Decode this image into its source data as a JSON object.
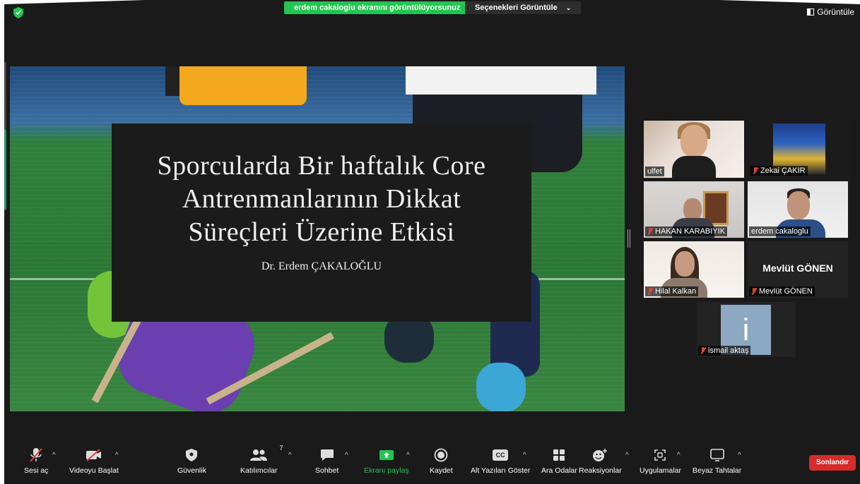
{
  "header": {
    "share_banner": "erdem cakaloglu ekranını görüntülüyorsunuz",
    "options_label": "Seçenekleri Görüntüle",
    "view_label": "Görüntüle"
  },
  "slide": {
    "title_line1": "Sporcularda Bir haftalık Core",
    "title_line2": "Antrenmanlarının Dikkat",
    "title_line3": "Süreçleri Üzerine Etkisi",
    "subtitle": "Dr. Erdem ÇAKALOĞLU"
  },
  "participants": [
    {
      "name": "ulfet",
      "muted": false
    },
    {
      "name": "Zekai ÇAKIR",
      "muted": true,
      "active_speaker": true
    },
    {
      "name": "HAKAN KARABIYIK",
      "muted": true
    },
    {
      "name": "erdem cakaloglu",
      "muted": false
    },
    {
      "name": "Hilal Kalkan",
      "muted": true
    },
    {
      "name": "Mevlüt GÖNEN",
      "display_name": "Mevlüt GÖNEN",
      "muted": true
    },
    {
      "name": "ismail aktaş",
      "avatar_letter": "i",
      "muted": true
    }
  ],
  "toolbar": {
    "audio": "Sesi aç",
    "video": "Videoyu Başlat",
    "security": "Güvenlik",
    "participants": "Katılımcılar",
    "participants_count": "7",
    "chat": "Sohbet",
    "share": "Ekranı paylaş",
    "record": "Kaydet",
    "captions": "Alt Yazıları Göster",
    "cc_icon_text": "CC",
    "breakout": "Ara Odalar",
    "reactions": "Reaksiyonlar",
    "apps": "Uygulamalar",
    "whiteboard": "Beyaz Tahtalar",
    "end": "Sonlandır"
  },
  "colors": {
    "share_green": "#23c552",
    "end_red": "#d62c2c",
    "active_border": "#d2df4a",
    "mute_red": "#e0433a"
  }
}
